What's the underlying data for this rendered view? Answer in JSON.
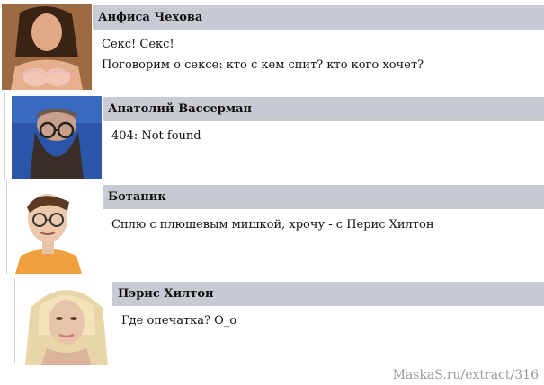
{
  "posts": [
    {
      "author": "Анфиса Чехова",
      "lines": [
        "Секс! Секс!",
        "Поговорим о сексе: кто с кем спит? кто кого хочет?"
      ],
      "avatar": "avatar-anfisa"
    },
    {
      "author": "Анатолий Вассерман",
      "lines": [
        "404: Not found"
      ],
      "avatar": "avatar-wasserman"
    },
    {
      "author": "Ботаник",
      "lines": [
        "Сплю с плюшевым мишкой, хрочу - с Перис Хилтон"
      ],
      "avatar": "avatar-nerd"
    },
    {
      "author": "Пэрис Хилтон",
      "lines": [
        "Где опечатка? O_o"
      ],
      "avatar": "avatar-paris"
    }
  ],
  "footer": "MaskaS.ru/extract/316",
  "colors": {
    "name_bar": "#c8cbd3",
    "footer_text": "#9a9a9a"
  }
}
